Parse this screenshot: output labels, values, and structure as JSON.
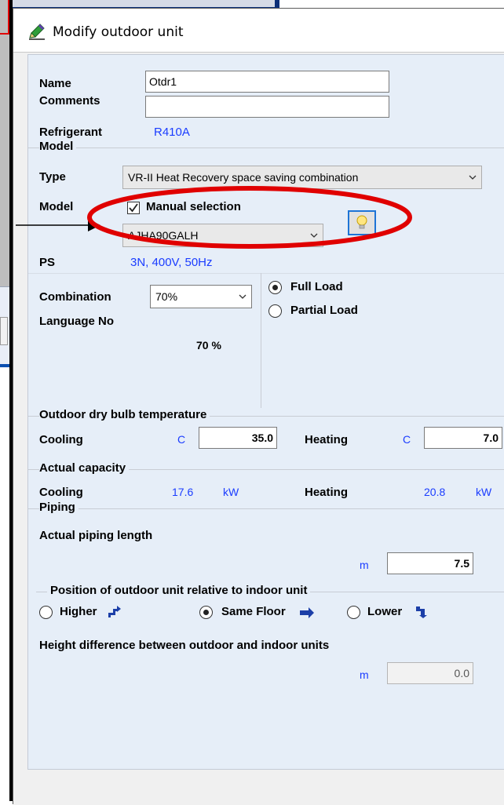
{
  "dialog": {
    "title": "Modify outdoor unit",
    "name_label": "Name",
    "name_value": "Otdr1",
    "comments_label": "Comments",
    "comments_value": "",
    "refrigerant_label": "Refrigerant",
    "refrigerant_value": "R410A"
  },
  "model_group": {
    "title": "Model",
    "type_label": "Type",
    "type_value": "VR-II Heat Recovery space saving combination",
    "model_label": "Model",
    "manual_selection_label": "Manual selection",
    "manual_selection_checked": true,
    "model_value": "AJHA90GALH",
    "ps_label": "PS",
    "ps_value": "3N, 400V, 50Hz",
    "combination_label": "Combination",
    "combination_value": "70%",
    "language_no_label": "Language No",
    "combination_percent": "70 %",
    "load_options": [
      {
        "label": "Full Load",
        "selected": true
      },
      {
        "label": "Partial Load",
        "selected": false
      }
    ]
  },
  "outdoor_temp": {
    "title": "Outdoor dry bulb temperature",
    "cooling_label": "Cooling",
    "cooling_unit": "C",
    "cooling_value": "35.0",
    "heating_label": "Heating",
    "heating_unit": "C",
    "heating_value": "7.0"
  },
  "actual_capacity": {
    "title": "Actual capacity",
    "cooling_label": "Cooling",
    "cooling_value": "17.6",
    "cooling_unit": "kW",
    "heating_label": "Heating",
    "heating_value": "20.8",
    "heating_unit": "kW"
  },
  "piping": {
    "title": "Piping",
    "actual_length_label": "Actual piping length",
    "length_unit": "m",
    "length_value": "7.5",
    "position_title": "Position of outdoor unit relative to indoor unit",
    "positions": [
      {
        "label": "Higher",
        "selected": false
      },
      {
        "label": "Same Floor",
        "selected": true
      },
      {
        "label": "Lower",
        "selected": false
      }
    ],
    "height_diff_label": "Height difference between outdoor and indoor units",
    "height_unit": "m",
    "height_value": "0.0"
  },
  "colors": {
    "accent_blue": "#1a3cff",
    "annotation_red": "#e00000",
    "panel_bg": "#e6eef8"
  }
}
